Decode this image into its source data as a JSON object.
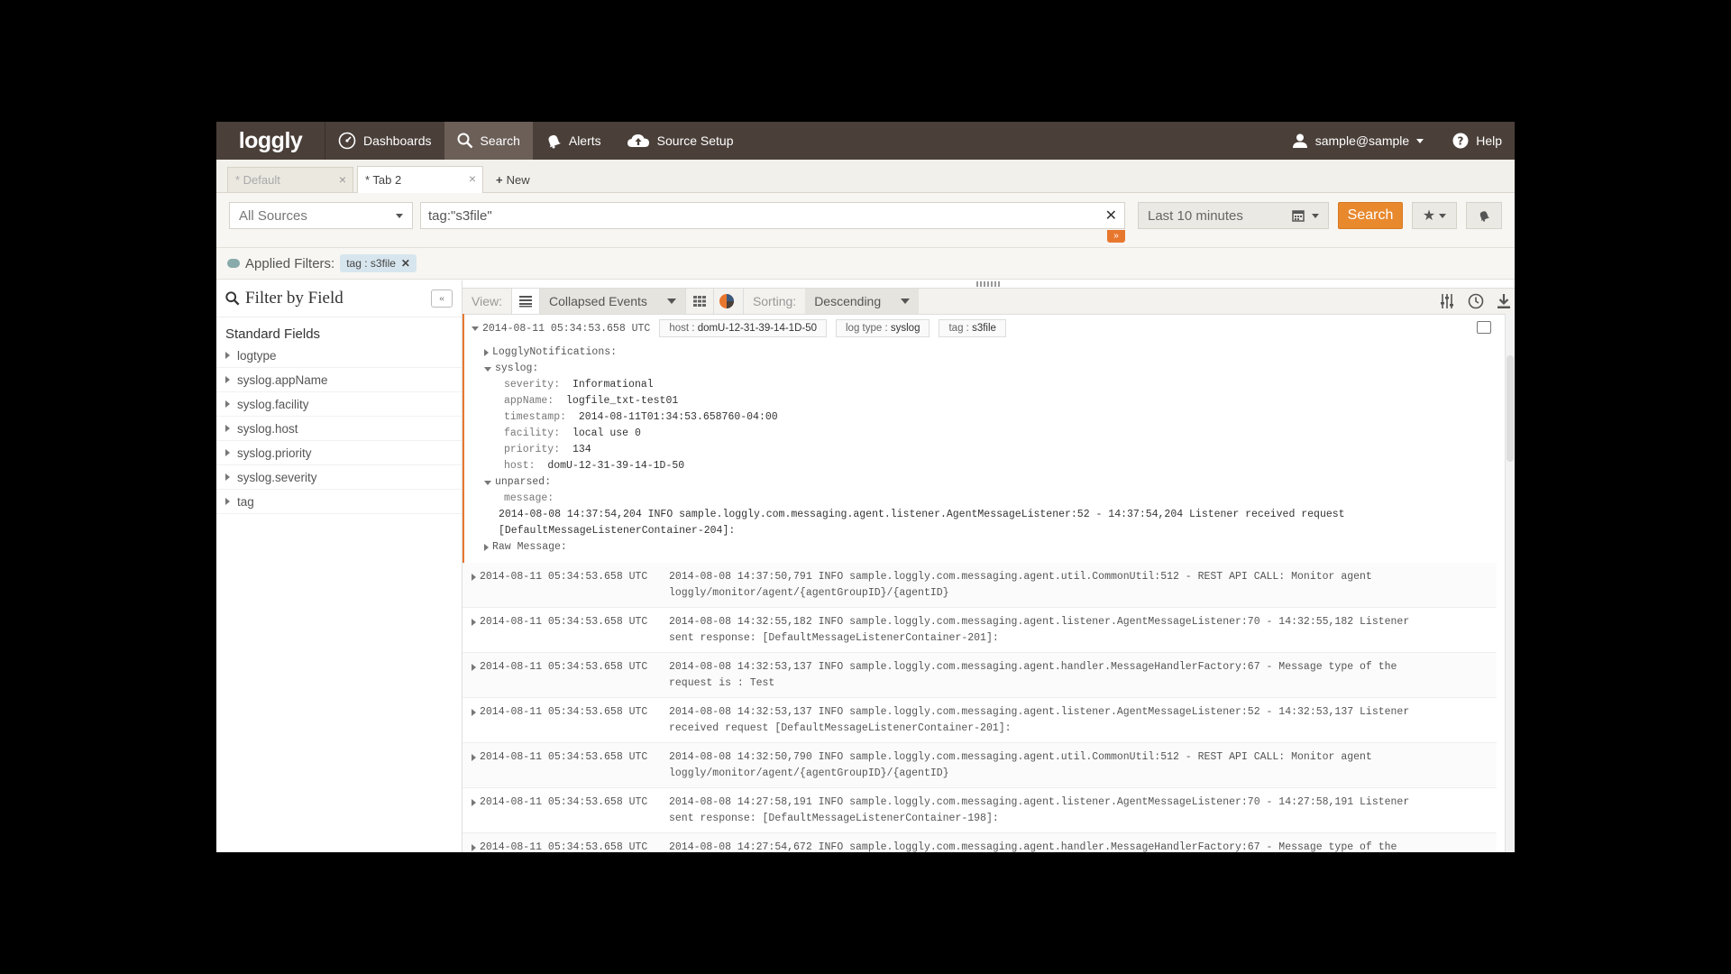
{
  "nav": {
    "logo": "loggly",
    "items": [
      {
        "label": "Dashboards",
        "icon": "dashboard-icon"
      },
      {
        "label": "Search",
        "icon": "search-icon",
        "active": true
      },
      {
        "label": "Alerts",
        "icon": "bell-icon"
      },
      {
        "label": "Source Setup",
        "icon": "cloud-upload-icon"
      }
    ],
    "user": "sample@sample",
    "help": "Help"
  },
  "tabs": {
    "items": [
      {
        "label": "* Default",
        "active": false
      },
      {
        "label": "* Tab 2",
        "active": true
      }
    ],
    "new_label": "New"
  },
  "search": {
    "sources": "All Sources",
    "query": "tag:\"s3file\"",
    "time_range": "Last 10 minutes",
    "button": "Search"
  },
  "filters": {
    "label": "Applied Filters:",
    "chips": [
      "tag : s3file"
    ]
  },
  "sidebar": {
    "title": "Filter by Field",
    "section": "Standard Fields",
    "fields": [
      "logtype",
      "syslog.appName",
      "syslog.facility",
      "syslog.host",
      "syslog.priority",
      "syslog.severity",
      "tag"
    ]
  },
  "toolbar": {
    "view_label": "View:",
    "view_value": "Collapsed Events",
    "sorting_label": "Sorting:",
    "sorting_value": "Descending"
  },
  "expanded_event": {
    "timestamp": "2014-08-11 05:34:53.658 UTC",
    "chips": [
      {
        "key": "host :",
        "value": "domU-12-31-39-14-1D-50"
      },
      {
        "key": "log type :",
        "value": "syslog"
      },
      {
        "key": "tag :",
        "value": "s3file"
      }
    ],
    "notifications_label": "LogglyNotifications:",
    "syslog_label": "syslog:",
    "syslog_fields": [
      {
        "k": "severity:",
        "v": "Informational"
      },
      {
        "k": "appName:",
        "v": "logfile_txt-test01"
      },
      {
        "k": "timestamp:",
        "v": "2014-08-11T01:34:53.658760-04:00"
      },
      {
        "k": "facility:",
        "v": "local use 0"
      },
      {
        "k": "priority:",
        "v": "134"
      },
      {
        "k": "host:",
        "v": "domU-12-31-39-14-1D-50"
      }
    ],
    "unparsed_label": "unparsed:",
    "message_label": "message:",
    "message_line1": "2014-08-08 14:37:54,204 INFO sample.loggly.com.messaging.agent.listener.AgentMessageListener:52 - 14:37:54,204 Listener received request",
    "message_line2": "[DefaultMessageListenerContainer-204]:",
    "raw_label": "Raw Message:"
  },
  "events": [
    {
      "ts": "2014-08-11 05:34:53.658 UTC",
      "l1": "2014-08-08 14:37:50,791 INFO sample.loggly.com.messaging.agent.util.CommonUtil:512 - REST API CALL: Monitor agent",
      "l2": "loggly/monitor/agent/{agentGroupID}/{agentID}"
    },
    {
      "ts": "2014-08-11 05:34:53.658 UTC",
      "l1": "2014-08-08 14:32:55,182 INFO sample.loggly.com.messaging.agent.listener.AgentMessageListener:70 - 14:32:55,182 Listener",
      "l2": "sent response: [DefaultMessageListenerContainer-201]:"
    },
    {
      "ts": "2014-08-11 05:34:53.658 UTC",
      "l1": "2014-08-08 14:32:53,137 INFO sample.loggly.com.messaging.agent.handler.MessageHandlerFactory:67 - Message type of the",
      "l2": "request is : Test"
    },
    {
      "ts": "2014-08-11 05:34:53.658 UTC",
      "l1": "2014-08-08 14:32:53,137 INFO sample.loggly.com.messaging.agent.listener.AgentMessageListener:52 - 14:32:53,137 Listener",
      "l2": "received request [DefaultMessageListenerContainer-201]:"
    },
    {
      "ts": "2014-08-11 05:34:53.658 UTC",
      "l1": "2014-08-08 14:32:50,790 INFO sample.loggly.com.messaging.agent.util.CommonUtil:512 - REST API CALL: Monitor agent",
      "l2": "loggly/monitor/agent/{agentGroupID}/{agentID}"
    },
    {
      "ts": "2014-08-11 05:34:53.658 UTC",
      "l1": "2014-08-08 14:27:58,191 INFO sample.loggly.com.messaging.agent.listener.AgentMessageListener:70 - 14:27:58,191 Listener",
      "l2": "sent response: [DefaultMessageListenerContainer-198]:"
    },
    {
      "ts": "2014-08-11 05:34:53.658 UTC",
      "l1": "2014-08-08 14:27:54,672 INFO sample.loggly.com.messaging.agent.handler.MessageHandlerFactory:67 - Message type of the",
      "l2": ""
    }
  ]
}
